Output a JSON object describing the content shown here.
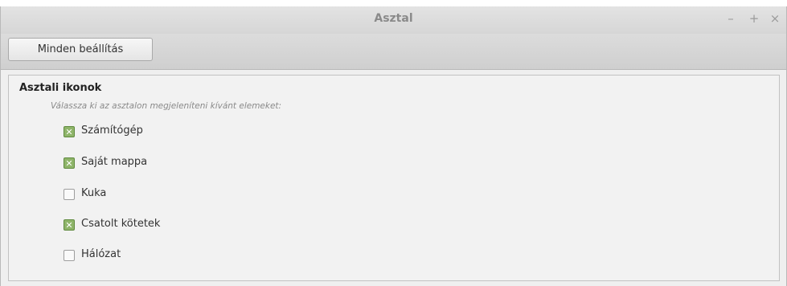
{
  "window": {
    "title": "Asztal",
    "controls": {
      "minimize": "–",
      "maximize": "+",
      "close": "×"
    }
  },
  "toolbar": {
    "all_settings_label": "Minden beállítás"
  },
  "section": {
    "title": "Asztali ikonok",
    "description": "Válassza ki az asztalon megjeleníteni kívánt elemeket:",
    "items": [
      {
        "label": "Számítógép",
        "checked": true
      },
      {
        "label": "Saját mappa",
        "checked": true
      },
      {
        "label": "Kuka",
        "checked": false
      },
      {
        "label": "Csatolt kötetek",
        "checked": true
      },
      {
        "label": "Hálózat",
        "checked": false
      }
    ]
  },
  "colors": {
    "checked_fill": "#8fb56a",
    "titlebar": "#dadada",
    "content_bg": "#f2f2f2"
  }
}
